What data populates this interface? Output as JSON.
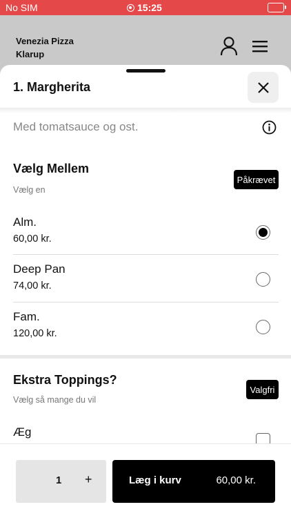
{
  "status": {
    "carrier": "No SIM",
    "time": "15:25"
  },
  "header": {
    "restaurant_line1": "Venezia Pizza",
    "restaurant_line2": "Klarup"
  },
  "sheet": {
    "title": "1. Margherita",
    "description": "Med tomatsauce og ost."
  },
  "group_size": {
    "title": "Vælg Mellem",
    "subtitle": "Vælg en",
    "badge": "Påkrævet",
    "options": [
      {
        "name": "Alm.",
        "price": "60,00 kr.",
        "selected": true
      },
      {
        "name": "Deep Pan",
        "price": "74,00 kr.",
        "selected": false
      },
      {
        "name": "Fam.",
        "price": "120,00 kr.",
        "selected": false
      }
    ]
  },
  "group_toppings": {
    "title": "Ekstra Toppings?",
    "subtitle": "Vælg så mange du vil",
    "badge": "Valgfri",
    "options": [
      {
        "name": "Æg",
        "checked": false
      }
    ]
  },
  "cart": {
    "quantity": "1",
    "plus": "+",
    "add_label": "Læg i kurv",
    "total": "60,00 kr."
  },
  "colors": {
    "status_bar": "#e44848",
    "accent": "#000000",
    "header_bg": "#c9c9c9"
  },
  "icons": [
    "record-icon",
    "battery-icon",
    "user-icon",
    "menu-icon",
    "close-icon",
    "info-icon"
  ]
}
